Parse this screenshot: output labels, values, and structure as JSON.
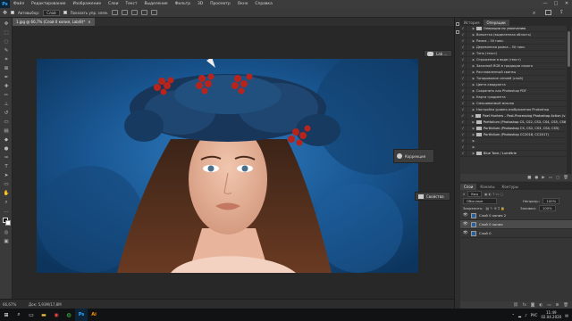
{
  "menubar": {
    "logo": "Ps",
    "items": [
      "Файл",
      "Редактирование",
      "Изображение",
      "Слои",
      "Текст",
      "Выделение",
      "Фильтр",
      "3D",
      "Просмотр",
      "Окно",
      "Справка"
    ]
  },
  "window_controls": {
    "minimize": "—",
    "maximize": "□",
    "close": "✕"
  },
  "options_bar": {
    "autoselect_label": "Автовыбор:",
    "autoselect_value": "Слой",
    "show_controls_label": "Показать упр. элем."
  },
  "document_tab": {
    "title": "1.jpg @ 66,7% (Слой 0 копия, Lab/8)*",
    "close": "×"
  },
  "floating": {
    "panel1": "Lab ...",
    "panel2": "Коррекция",
    "panel3": "Свойства"
  },
  "status": {
    "zoom": "66,67%",
    "doc": "Док: 5,93M/17,8M"
  },
  "right_panel": {
    "top_tabs": [
      "История",
      "Операции"
    ],
    "active_tab": "Операции",
    "actions": [
      {
        "label": "Операции по умолчанию",
        "type": "folder",
        "checked": true
      },
      {
        "label": "Виньетка (выделенная область)",
        "type": "item",
        "checked": true
      },
      {
        "label": "Рамка – 50 пикс.",
        "type": "item",
        "checked": true
      },
      {
        "label": "Деревянная рамка – 50 пикс.",
        "type": "item",
        "checked": true
      },
      {
        "label": "Тень (текст)",
        "type": "item",
        "checked": true
      },
      {
        "label": "Отражение в воде (текст)",
        "type": "item",
        "checked": true
      },
      {
        "label": "Заказной RGB в градации серого",
        "type": "item",
        "checked": true
      },
      {
        "label": "Расплавленный свинец",
        "type": "item",
        "checked": true
      },
      {
        "label": "Тонирование сепией (слой)",
        "type": "item",
        "checked": true
      },
      {
        "label": "Цвета квадранта",
        "type": "item",
        "checked": true
      },
      {
        "label": "Сохранить как Photoshop PDF",
        "type": "item",
        "checked": true
      },
      {
        "label": "Карта градиента",
        "type": "item",
        "checked": true
      },
      {
        "label": "Смешиваемый миксер",
        "type": "item",
        "checked": true
      },
      {
        "label": "Настройка уровня изображения Photoshop",
        "type": "item",
        "checked": true
      },
      {
        "label": "Pixel Hunters – Post-Processing Photoshop Action (v1.0)",
        "type": "folder",
        "checked": true
      },
      {
        "label": "Portfolium (Photoshop CS, CS2, CS3, CS4, CS5, CS6)",
        "type": "folder",
        "checked": true
      },
      {
        "label": "Portfolium (Photoshop CS, CS2, CS3, CS4, CS5)",
        "type": "folder",
        "checked": true
      },
      {
        "label": "Portfolium (Photoshop CC2018, CC2017)",
        "type": "folder",
        "checked": true
      },
      {
        "label": "",
        "type": "item",
        "checked": true
      },
      {
        "label": "",
        "type": "item",
        "checked": true
      },
      {
        "label": "Blue Tone / Lumétrie",
        "type": "folder",
        "checked": true
      }
    ],
    "footer_icons": [
      "■",
      "●",
      "▶",
      "▭",
      "▢",
      "🗑"
    ]
  },
  "layers_panel": {
    "tabs": [
      "Слои",
      "Каналы",
      "Контуры"
    ],
    "active_tab": "Слои",
    "kind_label": "Вид",
    "blend_mode": "Обычные",
    "opacity_label": "Непрозр.:",
    "opacity_value": "100%",
    "lock_label": "Закрепить:",
    "fill_label": "Заливка:",
    "fill_value": "100%",
    "layers": [
      {
        "name": "Слой 0 копия 2",
        "selected": false,
        "visible": true
      },
      {
        "name": "Слой 0 копия",
        "selected": true,
        "visible": true
      },
      {
        "name": "Слой 0",
        "selected": false,
        "visible": true
      }
    ]
  },
  "taskbar": {
    "language": "РУС",
    "time": "11:49",
    "date": "02.04.2020"
  },
  "colors": {
    "accent": "#31a8ff",
    "taskbar": "#101214"
  }
}
